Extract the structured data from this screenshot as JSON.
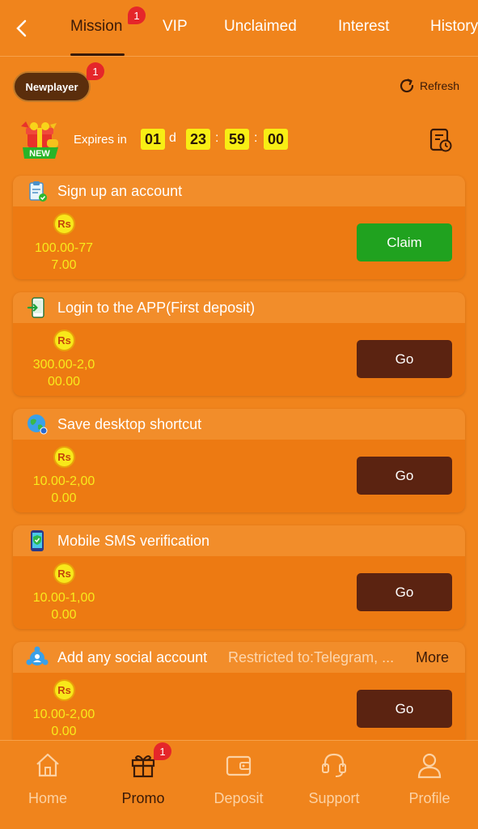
{
  "tabs": [
    {
      "label": "Mission",
      "badge": "1",
      "active": true
    },
    {
      "label": "VIP"
    },
    {
      "label": "Unclaimed"
    },
    {
      "label": "Interest"
    },
    {
      "label": "History"
    }
  ],
  "newplayer": {
    "label": "Newplayer",
    "badge": "1"
  },
  "refresh_label": "Refresh",
  "gift_badge": "NEW",
  "expires": {
    "label": "Expires in",
    "days": "01",
    "day_unit": "d",
    "hours": "23",
    "minutes": "59",
    "seconds": "00",
    "separator": ":"
  },
  "currency_symbol": "Rs",
  "tasks": [
    {
      "title": "Sign up an account",
      "reward_line1": "100.00-77",
      "reward_line2": "7.00",
      "button": "Claim",
      "icon": "clipboard-check-icon"
    },
    {
      "title": "Login to the APP(First deposit)",
      "reward_line1": "300.00-2,0",
      "reward_line2": "00.00",
      "button": "Go",
      "icon": "phone-login-icon"
    },
    {
      "title": "Save desktop shortcut",
      "reward_line1": "10.00-2,00",
      "reward_line2": "0.00",
      "button": "Go",
      "icon": "globe-icon"
    },
    {
      "title": "Mobile SMS verification",
      "reward_line1": "10.00-1,00",
      "reward_line2": "0.00",
      "button": "Go",
      "icon": "phone-shield-icon"
    },
    {
      "title": "Add any social account",
      "restriction": "Restricted to:Telegram, ...",
      "more": "More",
      "reward_line1": "10.00-2,00",
      "reward_line2": "0.00",
      "button": "Go",
      "icon": "social-icon"
    }
  ],
  "nav": [
    {
      "label": "Home",
      "icon": "home-icon"
    },
    {
      "label": "Promo",
      "icon": "gift-icon",
      "badge": "1",
      "active": true
    },
    {
      "label": "Deposit",
      "icon": "wallet-icon"
    },
    {
      "label": "Support",
      "icon": "headset-icon"
    },
    {
      "label": "Profile",
      "icon": "user-icon"
    }
  ],
  "colors": {
    "background": "#f0841c",
    "card": "#ed7a12",
    "claim_button": "#20a21f",
    "go_button": "#5b2311",
    "reward_text": "#f8ea1c",
    "badge": "#e5262a"
  }
}
